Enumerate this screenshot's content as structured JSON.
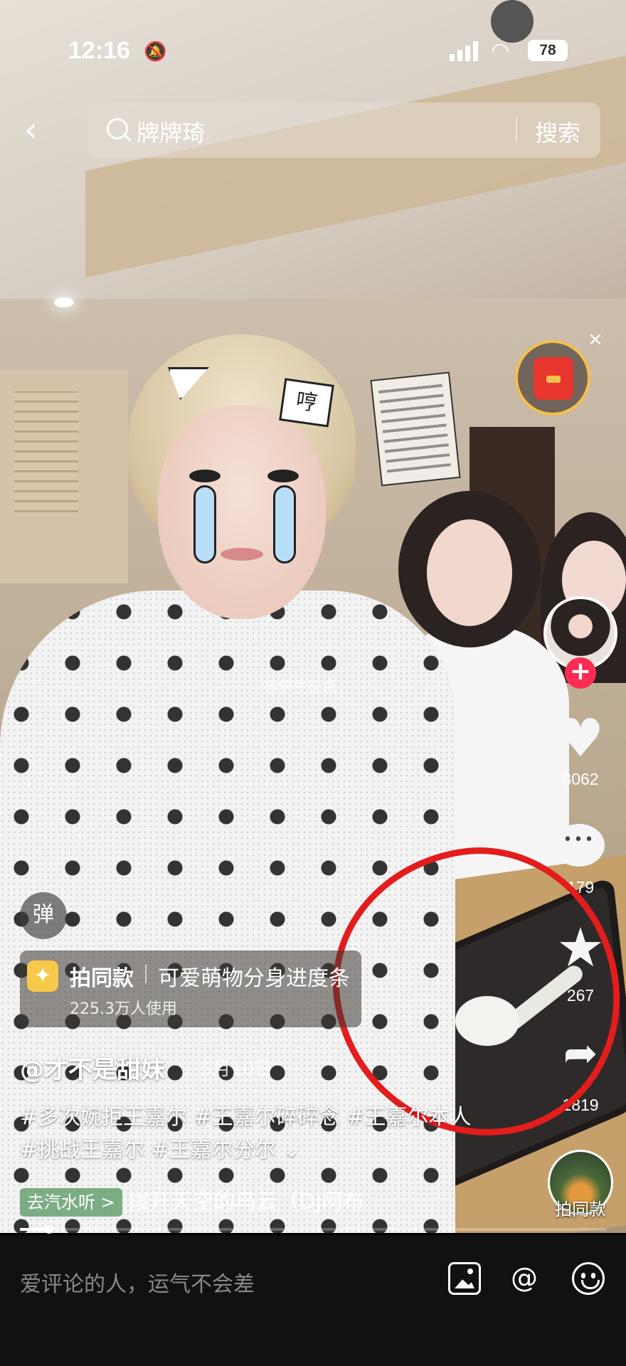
{
  "status_bar": {
    "time": "12:16",
    "bell_icon": "bell-slash-icon",
    "battery": "78"
  },
  "search": {
    "back_icon": "chevron-left-icon",
    "query": "牌牌琦",
    "button_label": "搜索"
  },
  "video": {
    "watermark": "@快手视点",
    "sticker_text": "哼"
  },
  "right_rail": {
    "likes": "8062",
    "comments": "179",
    "favorites": "267",
    "shares": "1819",
    "same_style_label": "拍同款",
    "follow_symbol": "+",
    "close_symbol": "×"
  },
  "danmu": {
    "label": "弹"
  },
  "effect": {
    "title": "拍同款",
    "name": "可爱萌物分身进度条",
    "users": "225.3万人使用"
  },
  "post": {
    "author": "@才不是甜妹",
    "date": "5月10日",
    "hashtags": "#多次婉拒王嘉尔 #王嘉尔碎碎念 #王嘉尔本人 #挑战王嘉尔 #王嘉尔分尔",
    "expand_icon": "chevron-down-icon"
  },
  "music": {
    "tag": "去汽水听 >",
    "name": "拨开天空的乌云（DJ阿布"
  },
  "progress": 0.05,
  "comment_bar": {
    "placeholder": "爱评论的人，运气不会差",
    "at_symbol": "@"
  },
  "colors": {
    "follow": "#fe2c55",
    "annotation": "#e31d1d",
    "packet": "#e8352d"
  }
}
